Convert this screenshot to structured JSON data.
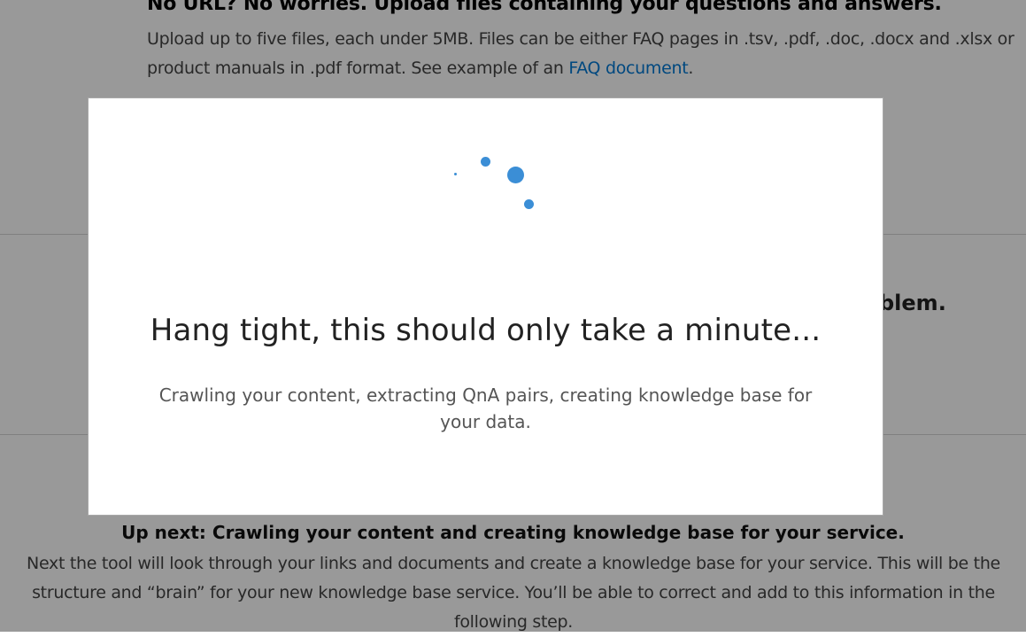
{
  "upload_section": {
    "title": "No URL? No worries. Upload files containing your questions and answers.",
    "description": "Upload up to five files, each under 5MB. Files can be either FAQ pages in .tsv, .pdf, .doc, .docx and .xlsx or product manuals in .pdf format. See example of an ",
    "link_text": "FAQ document",
    "description_end": "."
  },
  "background_heading_fragment": "blem.",
  "up_next": {
    "title": "Up next: Crawling your content and creating knowledge base for your service.",
    "description": "Next the tool will look through your links and documents and create a knowledge base for your service. This will be the structure and “brain” for your new knowledge base service. You’ll be able to correct and add to this information in the following step."
  },
  "loading_dialog": {
    "title": "Hang tight, this should only take a minute...",
    "message": "Crawling your content, extracting QnA pairs, creating knowledge base for your data.",
    "spinner_icon": "loading-spinner-icon",
    "accent_color": "#3b8ed6"
  }
}
